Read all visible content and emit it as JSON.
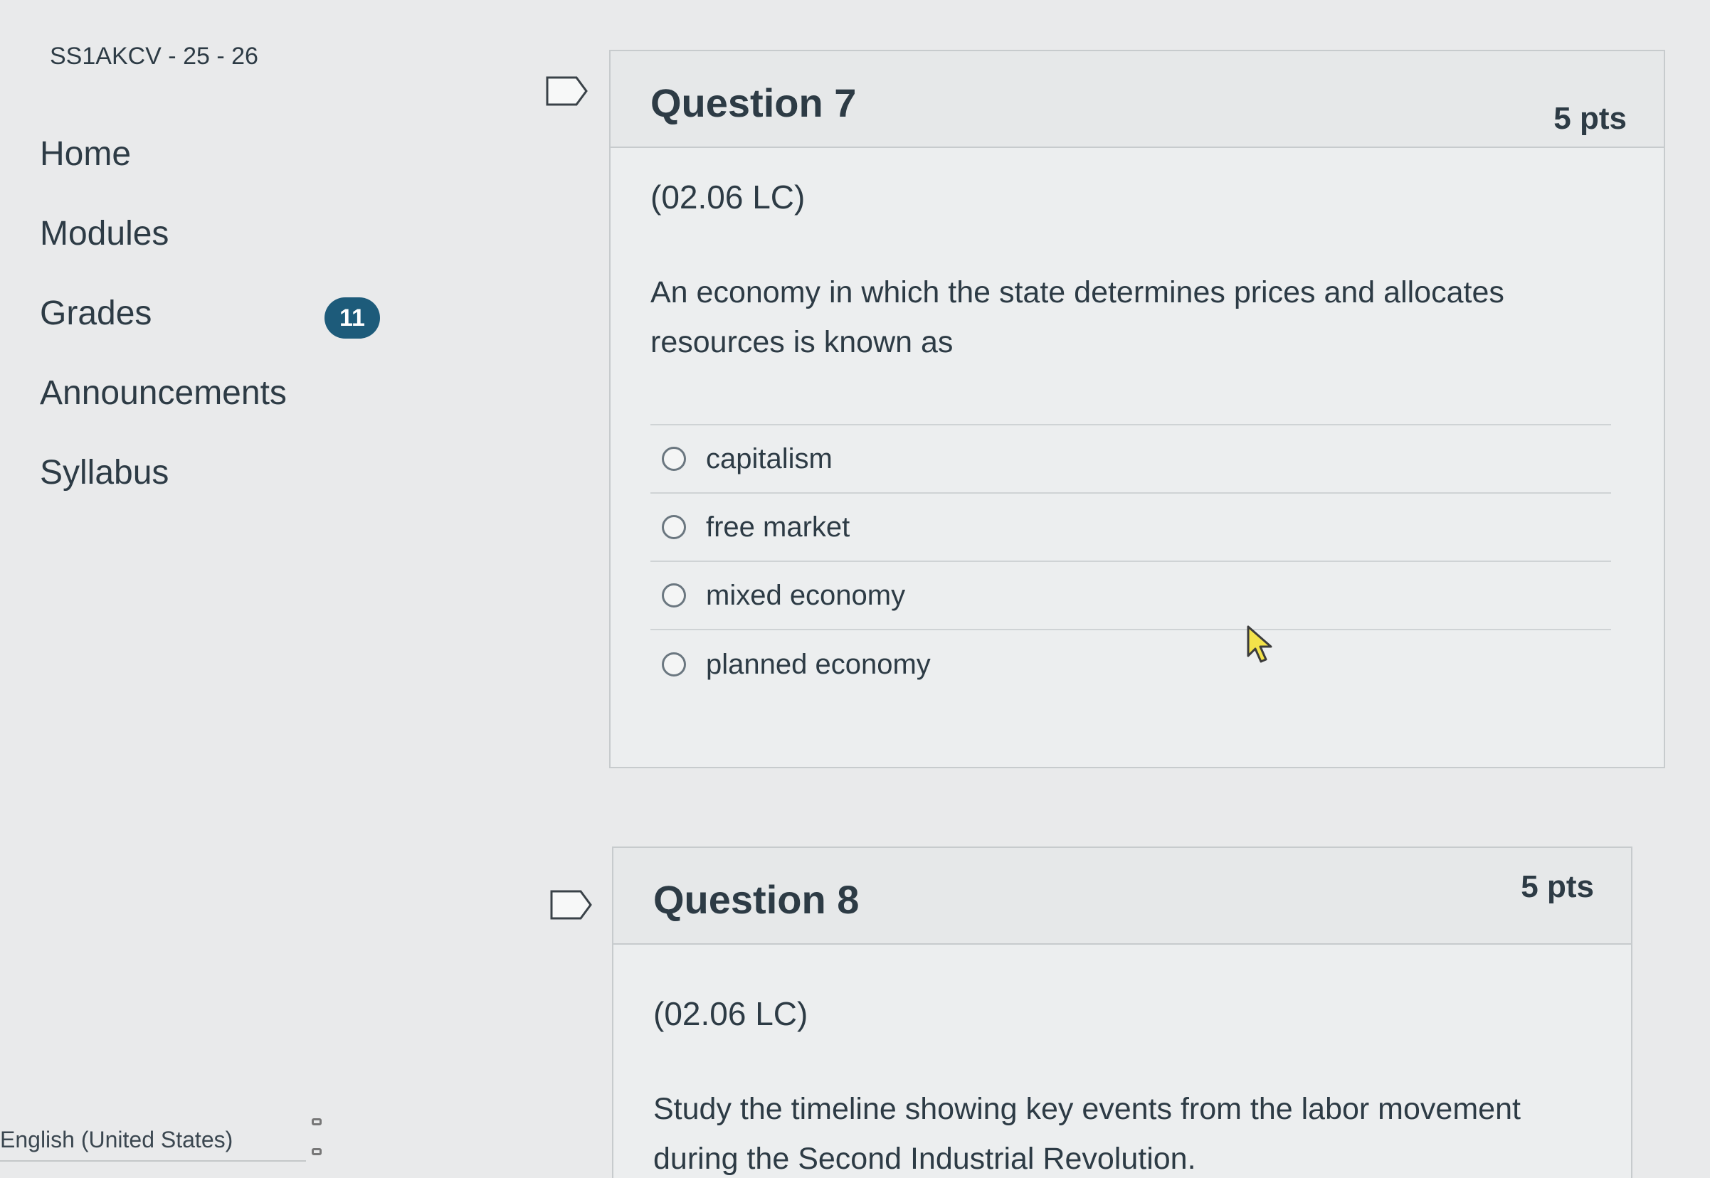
{
  "course": {
    "code": "SS1AKCV - 25 - 26"
  },
  "nav": {
    "items": [
      {
        "label": "Home"
      },
      {
        "label": "Modules"
      },
      {
        "label": "Grades",
        "badge": "11"
      },
      {
        "label": "Announcements"
      },
      {
        "label": "Syllabus"
      }
    ]
  },
  "footer": {
    "language": "English (United States)"
  },
  "questions": [
    {
      "title": "Question 7",
      "points": "5 pts",
      "code": "(02.06 LC)",
      "text": "An economy in which the state determines prices and allocates resources is known as",
      "answers": [
        {
          "label": "capitalism"
        },
        {
          "label": "free market"
        },
        {
          "label": "mixed economy"
        },
        {
          "label": "planned economy"
        }
      ]
    },
    {
      "title": "Question 8",
      "points": "5 pts",
      "code": "(02.06 LC)",
      "text": "Study the timeline showing key events from the labor movement during the Second Industrial Revolution."
    }
  ],
  "colors": {
    "badge": "#1d5b7a",
    "text": "#2d3b45",
    "background": "#e9eaeb"
  },
  "icons": {
    "flag": "flag-question-icon",
    "radio": "radio-button-icon",
    "cursor": "mouse-pointer-icon"
  }
}
